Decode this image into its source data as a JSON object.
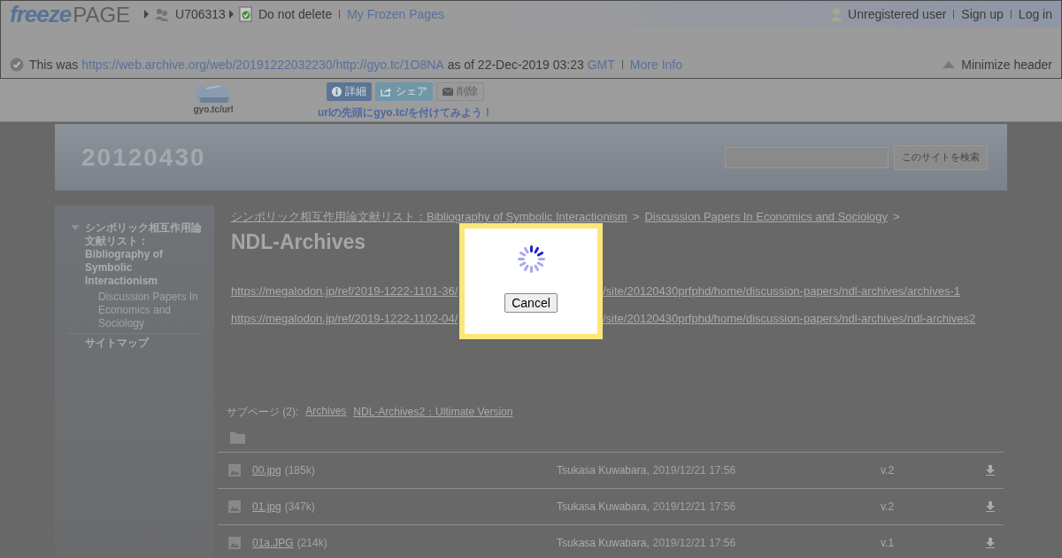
{
  "header": {
    "logo": {
      "part_1": "freeze",
      "part_2": "PAGE"
    },
    "user": "U706313",
    "status": "Do not delete",
    "my_pages": "My Frozen Pages",
    "account": {
      "user": "Unregistered user",
      "sign_up": "Sign up",
      "log_in": "Log in"
    },
    "source": {
      "prefix": "This was",
      "url": "https://web.archive.org/web/20191222032230/http://gyo.tc/1O8NA",
      "as_of": "as of 22-Dec-2019 03:23",
      "timezone": "GMT",
      "more_info": "More Info"
    },
    "minimize": "Minimize header"
  },
  "toolbar": {
    "logo_caption": "gyo.tc/url",
    "buttons": [
      {
        "kind": "info",
        "label": "詳細"
      },
      {
        "kind": "share",
        "label": "シェア"
      },
      {
        "kind": "delete",
        "label": "削除"
      }
    ],
    "hint": "urlの先頭にgyo.tc/を付けてみよう！"
  },
  "site": {
    "title": "20120430",
    "search": {
      "button": "このサイトを検索"
    },
    "sidebar": [
      {
        "label": "シンボリック相互作用論文献リスト：Bibliography of Symbolic Interactionism",
        "expanded": true,
        "children": [
          {
            "label": "Discussion Papers In Economics and Sociology"
          }
        ]
      },
      {
        "label": "サイトマップ"
      }
    ],
    "breadcrumb": {
      "items": [
        "シンボリック相互作用論文献リスト：Bibliography of Symbolic Interactionism",
        "Discussion Papers In Economics and Sociology"
      ],
      "separator": ">"
    },
    "page_title": "NDL-Archives",
    "links": [
      {
        "visible_start": "https://megalodon.jp/ref/2019-1222-1101-36/",
        "visible_end": "/site/20120430prfphd/home/discussion-papers/ndl-archives/archives-1"
      },
      {
        "visible_start": "https://megalodon.jp/ref/2019-1222-1102-04/",
        "visible_end": "/site/20120430prfphd/home/discussion-papers/ndl-archives/ndl-archives2"
      }
    ],
    "subpages": {
      "label": "サブページ (2):",
      "items": [
        "Archives",
        "NDL-Archives2：Ultimate Version"
      ]
    },
    "files": [
      {
        "name": "00.jpg",
        "size": "(185k)",
        "author": "Tsukasa Kuwabara,",
        "date": "2019/12/21 17:56",
        "version": "v.2"
      },
      {
        "name": "01.jpg",
        "size": "(347k)",
        "author": "Tsukasa Kuwabara,",
        "date": "2019/12/21 17:56",
        "version": "v.2"
      },
      {
        "name": "01a.JPG",
        "size": "(214k)",
        "author": "Tsukasa Kuwabara,",
        "date": "2019/12/21 17:56",
        "version": "v.1"
      }
    ]
  },
  "dialog": {
    "button": "Cancel"
  }
}
